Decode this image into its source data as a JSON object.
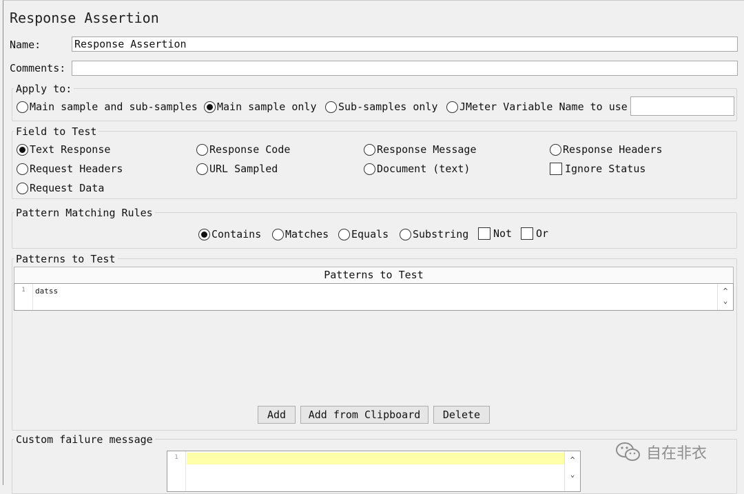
{
  "title": "Response Assertion",
  "name": {
    "label": "Name:",
    "value": "Response Assertion"
  },
  "comments": {
    "label": "Comments:",
    "value": ""
  },
  "apply_to": {
    "title": "Apply to:",
    "options": [
      {
        "label": "Main sample and sub-samples",
        "selected": false
      },
      {
        "label": "Main sample only",
        "selected": true
      },
      {
        "label": "Sub-samples only",
        "selected": false
      },
      {
        "label": "JMeter Variable Name to use",
        "selected": false
      }
    ],
    "variable_value": ""
  },
  "field_to_test": {
    "title": "Field to Test",
    "options": [
      {
        "label": "Text Response",
        "selected": true
      },
      {
        "label": "Response Code",
        "selected": false
      },
      {
        "label": "Response Message",
        "selected": false
      },
      {
        "label": "Response Headers",
        "selected": false
      },
      {
        "label": "Request Headers",
        "selected": false
      },
      {
        "label": "URL Sampled",
        "selected": false
      },
      {
        "label": "Document (text)",
        "selected": false
      },
      {
        "label": "Request Data",
        "selected": false
      }
    ],
    "ignore_status": {
      "label": "Ignore Status",
      "checked": false
    }
  },
  "pattern_rules": {
    "title": "Pattern Matching Rules",
    "options": [
      {
        "label": "Contains",
        "selected": true
      },
      {
        "label": "Matches",
        "selected": false
      },
      {
        "label": "Equals",
        "selected": false
      },
      {
        "label": "Substring",
        "selected": false
      }
    ],
    "not": {
      "label": "Not",
      "checked": false
    },
    "or": {
      "label": "Or",
      "checked": false
    }
  },
  "patterns": {
    "title": "Patterns to Test",
    "column_header": "Patterns to Test",
    "line_number": "1",
    "value": "datss",
    "buttons": {
      "add": "Add",
      "add_clipboard": "Add from Clipboard",
      "delete": "Delete"
    }
  },
  "failure": {
    "title": "Custom failure message",
    "line_number": "1",
    "value": ""
  },
  "icons": {
    "scroll_up": "^",
    "scroll_down": "⌄"
  },
  "watermark": {
    "text": "自在非衣"
  },
  "colors": {
    "highlight": "#ffffaa"
  }
}
